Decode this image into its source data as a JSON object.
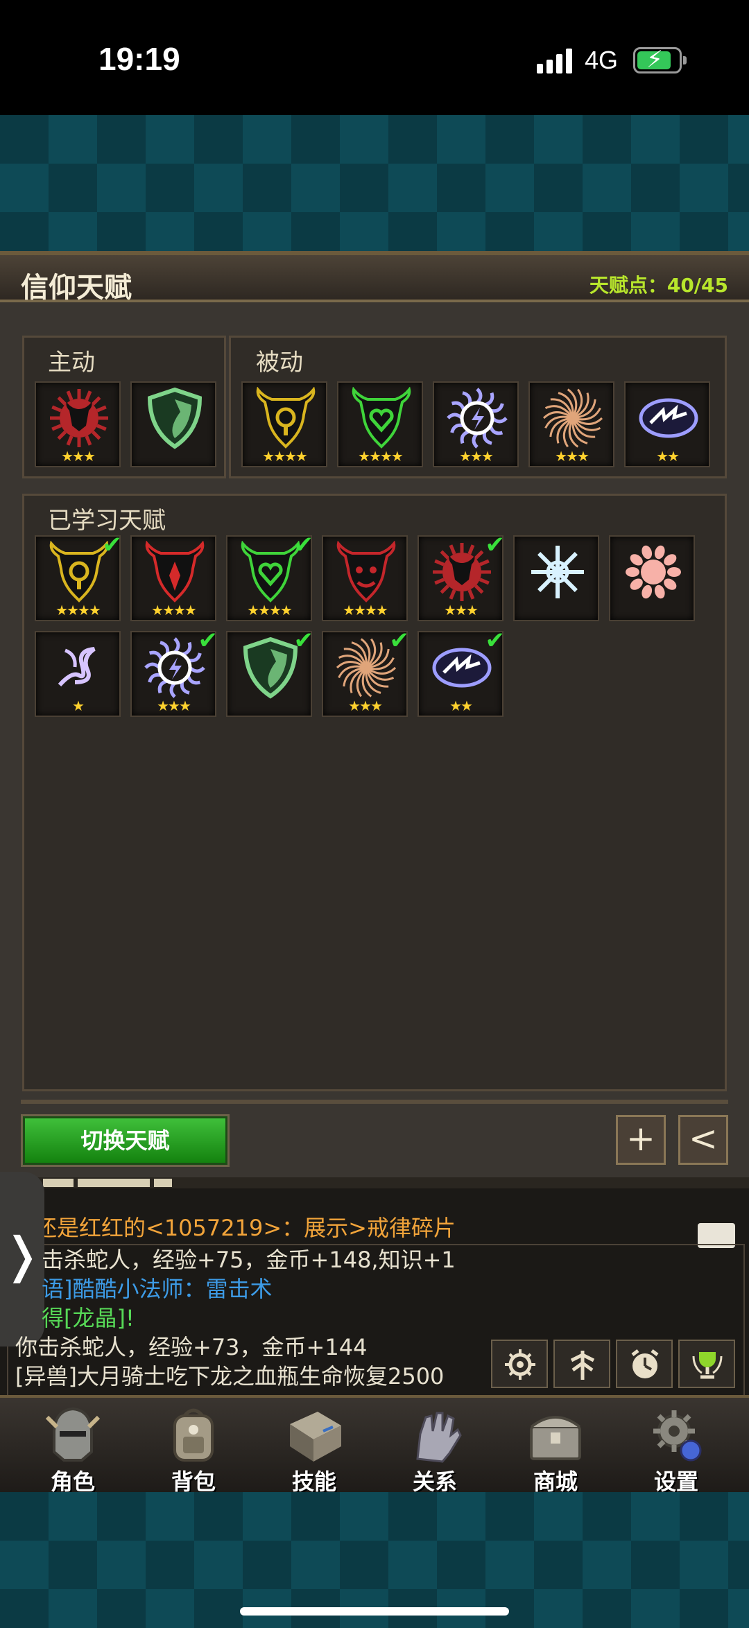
{
  "status_bar": {
    "time": "19:19",
    "network": "4G",
    "battery_charging": true
  },
  "header": {
    "title": "信仰天赋",
    "points_label": "天赋点：",
    "points_value": "40/45"
  },
  "active_section": {
    "label": "主动",
    "skills": [
      {
        "icon": "red-sun-bull-icon",
        "stars": "★★★",
        "color": "#b5262a"
      },
      {
        "icon": "green-shield-icon",
        "stars": "",
        "color": "#7fd48a"
      }
    ]
  },
  "passive_section": {
    "label": "被动",
    "skills": [
      {
        "icon": "gold-bull-icon",
        "stars": "★★★★",
        "color": "#d9b51f"
      },
      {
        "icon": "green-heart-bull-icon",
        "stars": "★★★★",
        "color": "#3fd43a"
      },
      {
        "icon": "blue-lightning-sun-icon",
        "stars": "★★★",
        "color": "#a9a5ff"
      },
      {
        "icon": "spiral-burst-icon",
        "stars": "★★★",
        "color": "#e0a57a"
      },
      {
        "icon": "lightning-oval-icon",
        "stars": "★★",
        "color": "#9d9dff"
      }
    ]
  },
  "learned_section": {
    "label": "已学习天赋",
    "skills": [
      {
        "icon": "gold-bull-icon",
        "stars": "★★★★",
        "checked": true,
        "color": "#d9b51f"
      },
      {
        "icon": "red-bull-icon",
        "stars": "★★★★",
        "checked": false,
        "color": "#d52a2a"
      },
      {
        "icon": "green-heart-bull-icon",
        "stars": "★★★★",
        "checked": true,
        "color": "#3fd43a"
      },
      {
        "icon": "red-demon-bull-icon",
        "stars": "★★★★",
        "checked": false,
        "color": "#c4262b"
      },
      {
        "icon": "red-sun-bull-icon",
        "stars": "★★★",
        "checked": true,
        "color": "#b5262a"
      },
      {
        "icon": "snowflake-icon",
        "stars": "",
        "checked": false,
        "color": "#d8f2ff"
      },
      {
        "icon": "pink-sun-icon",
        "stars": "",
        "checked": false,
        "color": "#f7b1a8"
      },
      {
        "icon": "wind-swirl-icon",
        "stars": "★",
        "checked": false,
        "color": "#d7c4ff"
      },
      {
        "icon": "blue-lightning-sun-icon",
        "stars": "★★★",
        "checked": true,
        "color": "#a9a5ff"
      },
      {
        "icon": "green-shield-icon",
        "stars": "",
        "checked": true,
        "color": "#7fd48a"
      },
      {
        "icon": "spiral-burst-icon",
        "stars": "★★★",
        "checked": true,
        "color": "#e0a57a"
      },
      {
        "icon": "lightning-oval-icon",
        "stars": "★★",
        "checked": true,
        "color": "#9d9dff"
      }
    ]
  },
  "buttons": {
    "switch_talent": "切换天赋",
    "add": "+",
    "back": "<"
  },
  "chat": {
    "first_line": "还是红红的<1057219>：展示>戒律碎片",
    "lines": [
      {
        "text": "击杀蛇人，经验+75，金币+148,知识+1",
        "color": "#e8e2d0"
      },
      {
        "text": "语]酷酷小法师：雷击术",
        "color": "#3d9be6"
      },
      {
        "text": "得[龙晶]!",
        "color": "#57d957"
      },
      {
        "text": "你击杀蛇人，经验+73，金币+144",
        "color": "#e8e2d0"
      },
      {
        "text": "[异兽]大月骑士吃下龙之血瓶生命恢复2500",
        "color": "#e8e2d0"
      }
    ]
  },
  "side_tab": {
    "label": "❭"
  },
  "nav": [
    {
      "label": "角色",
      "icon": "knight-helmet-icon"
    },
    {
      "label": "背包",
      "icon": "backpack-icon"
    },
    {
      "label": "技能",
      "icon": "skill-book-icon"
    },
    {
      "label": "关系",
      "icon": "gauntlet-icon"
    },
    {
      "label": "商城",
      "icon": "treasure-chest-icon"
    },
    {
      "label": "设置",
      "icon": "gear-icon"
    }
  ]
}
